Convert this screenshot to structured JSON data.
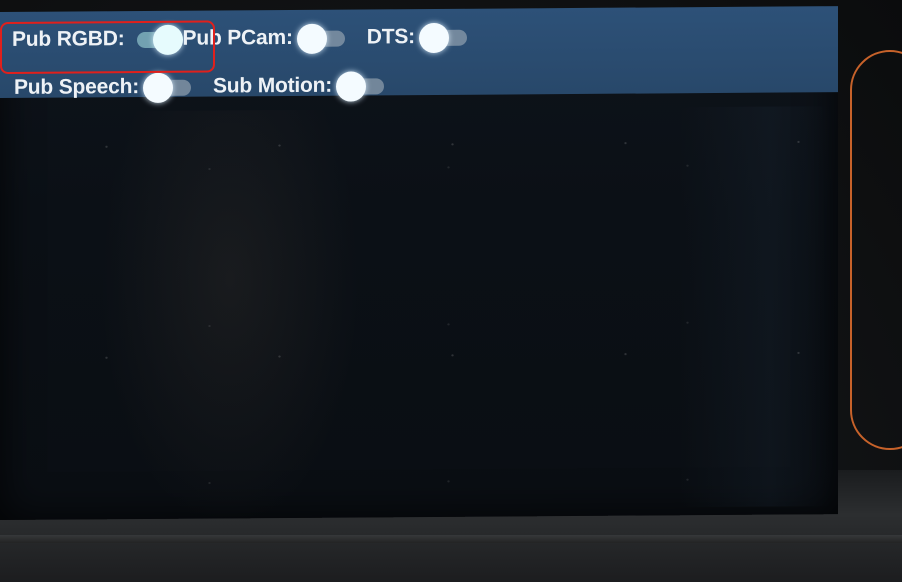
{
  "toolbar": {
    "items": [
      {
        "label": "Pub RGBD:",
        "on": true
      },
      {
        "label": "Pub PCam:",
        "on": false
      },
      {
        "label": "DTS:",
        "on": false
      },
      {
        "label": "Pub Speech:",
        "on": false
      },
      {
        "label": "Sub Motion:",
        "on": false
      }
    ]
  },
  "colors": {
    "toolbar_bg": "#2b4e72",
    "annotation_box": "#e0201c",
    "device_accent": "#c7622a"
  }
}
